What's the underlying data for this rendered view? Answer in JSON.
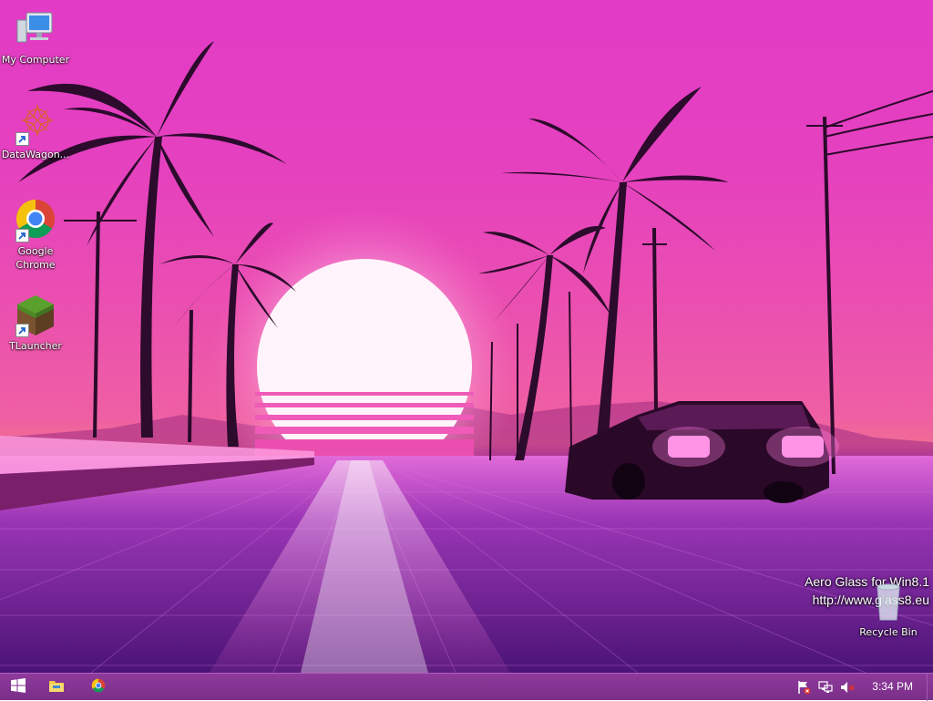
{
  "desktop": {
    "icons": [
      {
        "label": "My Computer",
        "icon": "computer-icon"
      },
      {
        "label": "DataWagon...",
        "icon": "datawagon-icon"
      },
      {
        "label": "Google Chrome",
        "icon": "chrome-icon"
      },
      {
        "label": "TLauncher",
        "icon": "minecraft-grass-icon"
      }
    ],
    "recycle_bin": {
      "label": "Recycle Bin",
      "icon": "recycle-bin-icon"
    },
    "watermark": {
      "line1": "Aero Glass for Win8.1",
      "line2": "http://www.glass8.eu"
    }
  },
  "taskbar": {
    "start": {
      "icon": "windows-start-icon"
    },
    "pinned": [
      {
        "icon": "file-explorer-icon"
      },
      {
        "icon": "chrome-icon"
      }
    ],
    "tray": [
      {
        "icon": "action-center-flag-icon"
      },
      {
        "icon": "network-icon"
      },
      {
        "icon": "volume-muted-icon"
      }
    ],
    "clock": "3:34 PM"
  },
  "colors": {
    "sky_top": "#e23bc6",
    "sun": "#fff4fb",
    "road": "#6a1fa0",
    "taskbar": "#8e3a9c"
  }
}
